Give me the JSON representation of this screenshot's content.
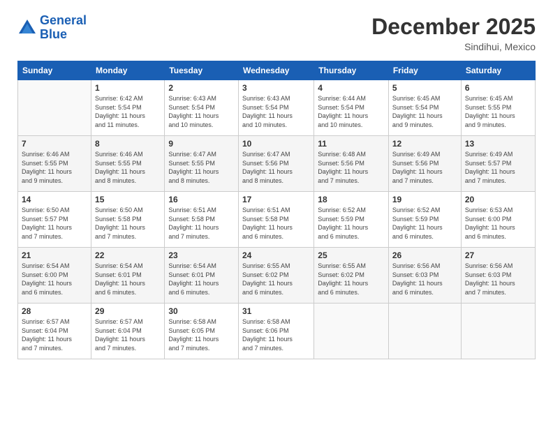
{
  "header": {
    "logo_line1": "General",
    "logo_line2": "Blue",
    "month_title": "December 2025",
    "location": "Sindihui, Mexico"
  },
  "weekdays": [
    "Sunday",
    "Monday",
    "Tuesday",
    "Wednesday",
    "Thursday",
    "Friday",
    "Saturday"
  ],
  "weeks": [
    [
      {
        "day": "",
        "info": ""
      },
      {
        "day": "1",
        "info": "Sunrise: 6:42 AM\nSunset: 5:54 PM\nDaylight: 11 hours\nand 11 minutes."
      },
      {
        "day": "2",
        "info": "Sunrise: 6:43 AM\nSunset: 5:54 PM\nDaylight: 11 hours\nand 10 minutes."
      },
      {
        "day": "3",
        "info": "Sunrise: 6:43 AM\nSunset: 5:54 PM\nDaylight: 11 hours\nand 10 minutes."
      },
      {
        "day": "4",
        "info": "Sunrise: 6:44 AM\nSunset: 5:54 PM\nDaylight: 11 hours\nand 10 minutes."
      },
      {
        "day": "5",
        "info": "Sunrise: 6:45 AM\nSunset: 5:54 PM\nDaylight: 11 hours\nand 9 minutes."
      },
      {
        "day": "6",
        "info": "Sunrise: 6:45 AM\nSunset: 5:55 PM\nDaylight: 11 hours\nand 9 minutes."
      }
    ],
    [
      {
        "day": "7",
        "info": "Sunrise: 6:46 AM\nSunset: 5:55 PM\nDaylight: 11 hours\nand 9 minutes."
      },
      {
        "day": "8",
        "info": "Sunrise: 6:46 AM\nSunset: 5:55 PM\nDaylight: 11 hours\nand 8 minutes."
      },
      {
        "day": "9",
        "info": "Sunrise: 6:47 AM\nSunset: 5:55 PM\nDaylight: 11 hours\nand 8 minutes."
      },
      {
        "day": "10",
        "info": "Sunrise: 6:47 AM\nSunset: 5:56 PM\nDaylight: 11 hours\nand 8 minutes."
      },
      {
        "day": "11",
        "info": "Sunrise: 6:48 AM\nSunset: 5:56 PM\nDaylight: 11 hours\nand 7 minutes."
      },
      {
        "day": "12",
        "info": "Sunrise: 6:49 AM\nSunset: 5:56 PM\nDaylight: 11 hours\nand 7 minutes."
      },
      {
        "day": "13",
        "info": "Sunrise: 6:49 AM\nSunset: 5:57 PM\nDaylight: 11 hours\nand 7 minutes."
      }
    ],
    [
      {
        "day": "14",
        "info": "Sunrise: 6:50 AM\nSunset: 5:57 PM\nDaylight: 11 hours\nand 7 minutes."
      },
      {
        "day": "15",
        "info": "Sunrise: 6:50 AM\nSunset: 5:58 PM\nDaylight: 11 hours\nand 7 minutes."
      },
      {
        "day": "16",
        "info": "Sunrise: 6:51 AM\nSunset: 5:58 PM\nDaylight: 11 hours\nand 7 minutes."
      },
      {
        "day": "17",
        "info": "Sunrise: 6:51 AM\nSunset: 5:58 PM\nDaylight: 11 hours\nand 6 minutes."
      },
      {
        "day": "18",
        "info": "Sunrise: 6:52 AM\nSunset: 5:59 PM\nDaylight: 11 hours\nand 6 minutes."
      },
      {
        "day": "19",
        "info": "Sunrise: 6:52 AM\nSunset: 5:59 PM\nDaylight: 11 hours\nand 6 minutes."
      },
      {
        "day": "20",
        "info": "Sunrise: 6:53 AM\nSunset: 6:00 PM\nDaylight: 11 hours\nand 6 minutes."
      }
    ],
    [
      {
        "day": "21",
        "info": "Sunrise: 6:54 AM\nSunset: 6:00 PM\nDaylight: 11 hours\nand 6 minutes."
      },
      {
        "day": "22",
        "info": "Sunrise: 6:54 AM\nSunset: 6:01 PM\nDaylight: 11 hours\nand 6 minutes."
      },
      {
        "day": "23",
        "info": "Sunrise: 6:54 AM\nSunset: 6:01 PM\nDaylight: 11 hours\nand 6 minutes."
      },
      {
        "day": "24",
        "info": "Sunrise: 6:55 AM\nSunset: 6:02 PM\nDaylight: 11 hours\nand 6 minutes."
      },
      {
        "day": "25",
        "info": "Sunrise: 6:55 AM\nSunset: 6:02 PM\nDaylight: 11 hours\nand 6 minutes."
      },
      {
        "day": "26",
        "info": "Sunrise: 6:56 AM\nSunset: 6:03 PM\nDaylight: 11 hours\nand 6 minutes."
      },
      {
        "day": "27",
        "info": "Sunrise: 6:56 AM\nSunset: 6:03 PM\nDaylight: 11 hours\nand 7 minutes."
      }
    ],
    [
      {
        "day": "28",
        "info": "Sunrise: 6:57 AM\nSunset: 6:04 PM\nDaylight: 11 hours\nand 7 minutes."
      },
      {
        "day": "29",
        "info": "Sunrise: 6:57 AM\nSunset: 6:04 PM\nDaylight: 11 hours\nand 7 minutes."
      },
      {
        "day": "30",
        "info": "Sunrise: 6:58 AM\nSunset: 6:05 PM\nDaylight: 11 hours\nand 7 minutes."
      },
      {
        "day": "31",
        "info": "Sunrise: 6:58 AM\nSunset: 6:06 PM\nDaylight: 11 hours\nand 7 minutes."
      },
      {
        "day": "",
        "info": ""
      },
      {
        "day": "",
        "info": ""
      },
      {
        "day": "",
        "info": ""
      }
    ]
  ]
}
